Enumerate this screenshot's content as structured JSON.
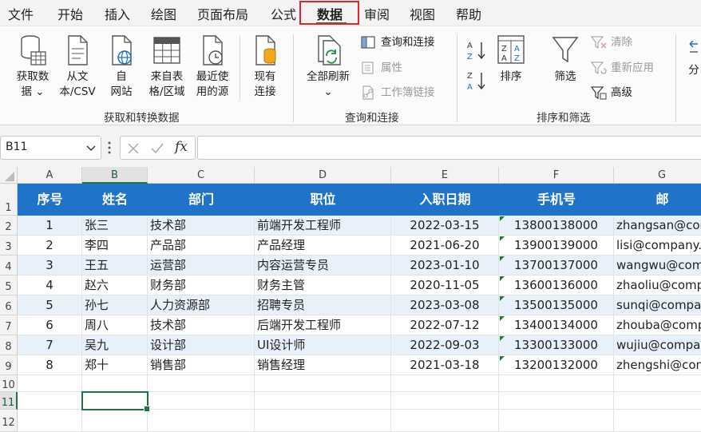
{
  "menu": {
    "items": [
      "文件",
      "开始",
      "插入",
      "绘图",
      "页面布局",
      "公式",
      "数据",
      "审阅",
      "视图",
      "帮助"
    ],
    "active": "数据"
  },
  "ribbon": {
    "groups": {
      "get_transform": "获取和转换数据",
      "query_connections": "查询和连接",
      "sort_filter": "排序和筛选"
    },
    "get_data": [
      "获取数",
      "据"
    ],
    "from_text": [
      "从文",
      "本/CSV"
    ],
    "from_web": [
      "自",
      "网站"
    ],
    "from_table": [
      "来自表",
      "格/区域"
    ],
    "recent_sources": [
      "最近使",
      "用的源"
    ],
    "existing_connections": [
      "现有",
      "连接"
    ],
    "refresh_all": "全部刷新",
    "queries_connections": "查询和连接",
    "properties": "属性",
    "workbook_links": "工作簿链接",
    "sort": "排序",
    "filter": "筛选",
    "clear": "清除",
    "reapply": "重新应用",
    "advanced": "高级",
    "cut_off": "分"
  },
  "formula_bar": {
    "name_box": "B11",
    "fx": "fx",
    "formula": ""
  },
  "grid": {
    "columns": [
      "A",
      "B",
      "C",
      "D",
      "E",
      "F",
      "G"
    ],
    "selected_column": "B",
    "rows": [
      "1",
      "2",
      "3",
      "4",
      "5",
      "6",
      "7",
      "8",
      "9",
      "10",
      "11",
      "12"
    ],
    "selected_row": "11",
    "selected_cell": "B11",
    "headers": [
      "序号",
      "姓名",
      "部门",
      "职位",
      "入职日期",
      "手机号",
      "邮"
    ],
    "data": [
      [
        "1",
        "张三",
        "技术部",
        "前端开发工程师",
        "2022-03-15",
        "13800138000",
        "zhangsan@com"
      ],
      [
        "2",
        "李四",
        "产品部",
        "产品经理",
        "2021-06-20",
        "13900139000",
        "lisi@company."
      ],
      [
        "3",
        "王五",
        "运营部",
        "内容运营专员",
        "2023-01-10",
        "13700137000",
        "wangwu@com"
      ],
      [
        "4",
        "赵六",
        "财务部",
        "财务主管",
        "2020-11-05",
        "13600136000",
        "zhaoliu@comp"
      ],
      [
        "5",
        "孙七",
        "人力资源部",
        "招聘专员",
        "2023-03-08",
        "13500135000",
        "sunqi@compa"
      ],
      [
        "6",
        "周八",
        "技术部",
        "后端开发工程师",
        "2022-07-12",
        "13400134000",
        "zhouba@comp"
      ],
      [
        "7",
        "吴九",
        "设计部",
        "UI设计师",
        "2022-09-03",
        "13300133000",
        "wujiu@compa"
      ],
      [
        "8",
        "郑十",
        "销售部",
        "销售经理",
        "2021-03-18",
        "13200132000",
        "zhengshi@com"
      ]
    ]
  },
  "colors": {
    "header_fill": "#1f74c9",
    "stripe": "#e8f0f9",
    "accent": "#217346",
    "highlight_border": "#e0262b"
  }
}
